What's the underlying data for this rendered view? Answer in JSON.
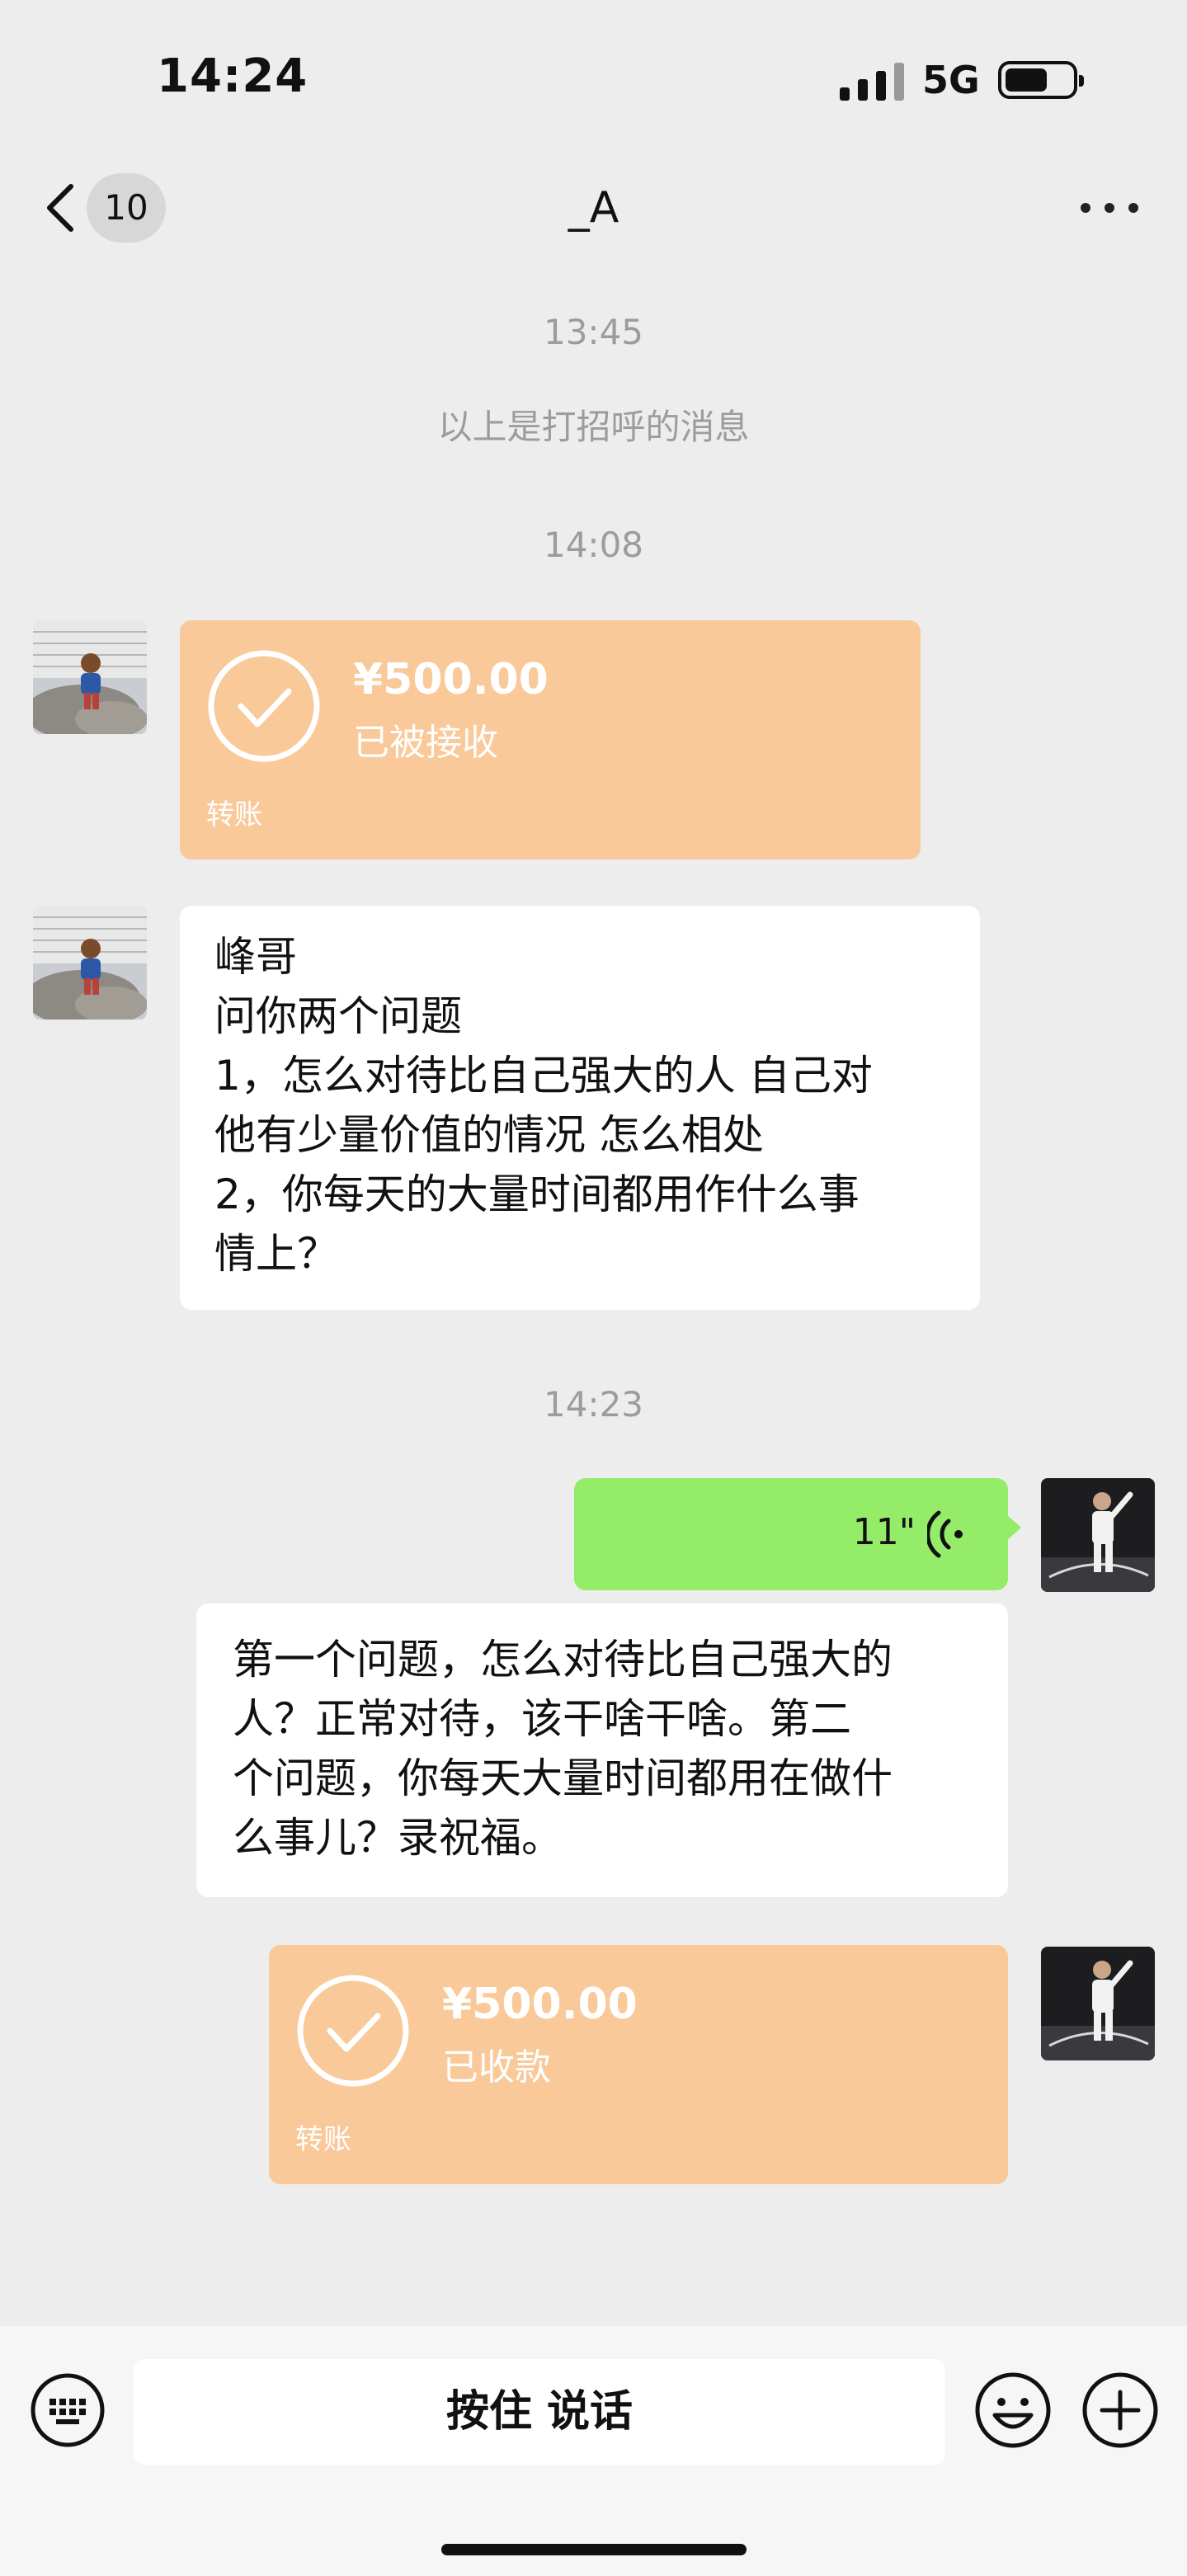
{
  "status_bar": {
    "time": "14:24",
    "network": "5G"
  },
  "header": {
    "back_count": "10",
    "title": "_A"
  },
  "messages": {
    "ts1": "13:45",
    "system_note": "以上是打招呼的消息",
    "ts2": "14:08",
    "transfer_in": {
      "amount": "¥500.00",
      "status": "已被接收",
      "label": "转账"
    },
    "question_lines": [
      "峰哥",
      "问你两个问题",
      "1，怎么对待比自己强大的人 自己对",
      "他有少量价值的情况 怎么相处",
      "2，你每天的大量时间都用作什么事",
      "情上？"
    ],
    "ts3": "14:23",
    "voice_duration": "11\"",
    "transcript_lines": [
      "第一个问题，怎么对待比自己强大的",
      "人？正常对待，该干啥干啥。第二",
      "个问题，你每天大量时间都用在做什",
      "么事儿？录祝福。"
    ],
    "transfer_out": {
      "amount": "¥500.00",
      "status": "已收款",
      "label": "转账"
    }
  },
  "bottom": {
    "talk_label": "按住 说话"
  },
  "colors": {
    "background": "#ededed",
    "transfer": "#f9c99a",
    "voice": "#95ec69",
    "bubble": "#ffffff"
  }
}
